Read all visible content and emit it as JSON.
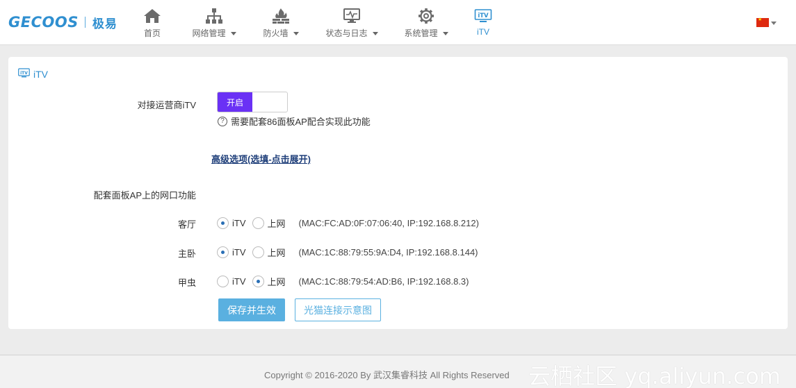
{
  "brand": {
    "logo_text": "GECOOS",
    "logo_cn": "极易"
  },
  "nav": [
    {
      "label": "首页",
      "icon": "home-icon",
      "has_caret": false,
      "active": false
    },
    {
      "label": "网络管理",
      "icon": "network-icon",
      "has_caret": true,
      "active": false
    },
    {
      "label": "防火墙",
      "icon": "firewall-icon",
      "has_caret": true,
      "active": false
    },
    {
      "label": "状态与日志",
      "icon": "monitor-icon",
      "has_caret": true,
      "active": false
    },
    {
      "label": "系统管理",
      "icon": "gear-icon",
      "has_caret": true,
      "active": false
    },
    {
      "label": "iTV",
      "icon": "tv-icon",
      "has_caret": false,
      "active": true
    }
  ],
  "language": {
    "flag": "china-flag-icon"
  },
  "panel": {
    "title": "iTV",
    "itv_label": "对接运营商iTV",
    "toggle_on_label": "开启",
    "hint": "需要配套86面板AP配合实现此功能",
    "advanced_link": "高级选项(选填-点击展开)",
    "port_section_label": "配套面板AP上的网口功能",
    "option_itv": "iTV",
    "option_internet": "上网",
    "rooms": [
      {
        "name": "客厅",
        "selected": "itv",
        "info": "(MAC:FC:AD:0F:07:06:40, IP:192.168.8.212)"
      },
      {
        "name": "主卧",
        "selected": "itv",
        "info": "(MAC:1C:88:79:55:9A:D4, IP:192.168.8.144)"
      },
      {
        "name": "甲虫",
        "selected": "internet",
        "info": "(MAC:1C:88:79:54:AD:B6, IP:192.168.8.3)"
      }
    ],
    "save_button": "保存并生效",
    "diagram_button": "光猫连接示意图"
  },
  "footer": {
    "copyright": "Copyright © 2016-2020 By 武汉集睿科技 All Rights Reserved",
    "watermark": "云栖社区 yq.aliyun.com"
  },
  "colors": {
    "accent": "#2f8fd0",
    "toggle_on": "#6a31f5",
    "button_primary": "#5ab0e0",
    "link": "#1f3f7a"
  }
}
